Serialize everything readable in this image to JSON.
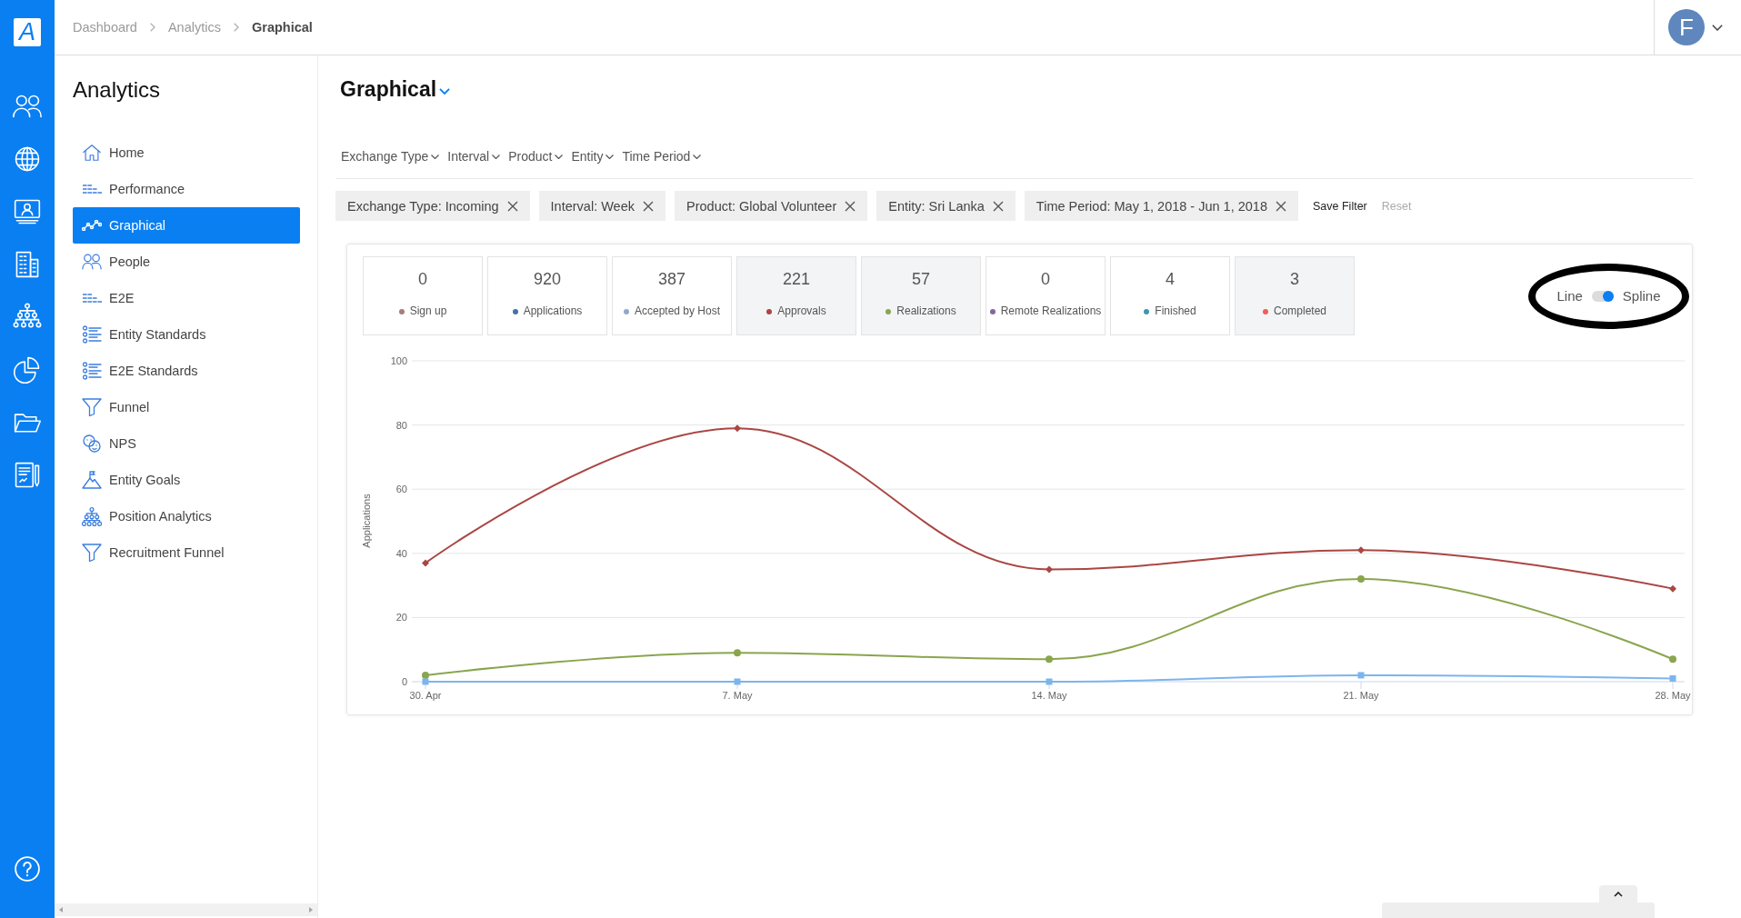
{
  "logo": "A",
  "breadcrumb": [
    {
      "label": "Dashboard",
      "current": false
    },
    {
      "label": "Analytics",
      "current": false
    },
    {
      "label": "Graphical",
      "current": true
    }
  ],
  "user": {
    "initial": "F"
  },
  "sidebar": {
    "title": "Analytics",
    "items": [
      {
        "label": "Home",
        "selected": false
      },
      {
        "label": "Performance",
        "selected": false
      },
      {
        "label": "Graphical",
        "selected": true
      },
      {
        "label": "People",
        "selected": false
      },
      {
        "label": "E2E",
        "selected": false
      },
      {
        "label": "Entity Standards",
        "selected": false
      },
      {
        "label": "E2E Standards",
        "selected": false
      },
      {
        "label": "Funnel",
        "selected": false
      },
      {
        "label": "NPS",
        "selected": false
      },
      {
        "label": "Entity Goals",
        "selected": false
      },
      {
        "label": "Position Analytics",
        "selected": false
      },
      {
        "label": "Recruitment Funnel",
        "selected": false
      }
    ]
  },
  "page": {
    "title": "Graphical"
  },
  "filters": [
    "Exchange Type",
    "Interval",
    "Product",
    "Entity",
    "Time Period"
  ],
  "active_filters": [
    "Exchange Type: Incoming",
    "Interval: Week",
    "Product: Global Volunteer",
    "Entity: Sri Lanka",
    "Time Period: May 1, 2018 - Jun 1, 2018"
  ],
  "filter_actions": [
    {
      "label": "Save Filter",
      "disabled": false
    },
    {
      "label": "Reset",
      "disabled": true
    }
  ],
  "metrics": [
    {
      "value": "0",
      "label": "Sign up",
      "color": "#a47d7c",
      "selected": false
    },
    {
      "value": "920",
      "label": "Applications",
      "color": "#4572a7",
      "selected": false
    },
    {
      "value": "387",
      "label": "Accepted by Host",
      "color": "#92a8cd",
      "selected": false
    },
    {
      "value": "221",
      "label": "Approvals",
      "color": "#aa4643",
      "selected": true
    },
    {
      "value": "57",
      "label": "Realizations",
      "color": "#89a54e",
      "selected": true
    },
    {
      "value": "0",
      "label": "Remote Realizations",
      "color": "#80699b",
      "selected": false
    },
    {
      "value": "4",
      "label": "Finished",
      "color": "#3d96ae",
      "selected": false
    },
    {
      "value": "3",
      "label": "Completed",
      "color": "#f45b5b",
      "selected": true
    }
  ],
  "chart_mode": {
    "left_label": "Line",
    "right_label": "Spline",
    "on": true
  },
  "chart": {
    "chart_data": {
      "type": "line",
      "ylabel": "Applications",
      "categories": [
        "30. Apr",
        "7. May",
        "14. May",
        "21. May",
        "28. May"
      ],
      "series": [
        {
          "color": "#aa4643",
          "marker": "diamond",
          "values": [
            37,
            79,
            35,
            41,
            29
          ]
        },
        {
          "color": "#89a54e",
          "marker": "circle",
          "values": [
            2,
            9,
            7,
            32,
            7
          ]
        },
        {
          "color": "#7cb5ec",
          "marker": "square",
          "values": [
            0,
            0,
            0,
            2,
            1
          ]
        }
      ],
      "ylim": [
        0,
        100
      ],
      "yticks": [
        0,
        20,
        40,
        60,
        80,
        100
      ],
      "grid": true
    }
  }
}
